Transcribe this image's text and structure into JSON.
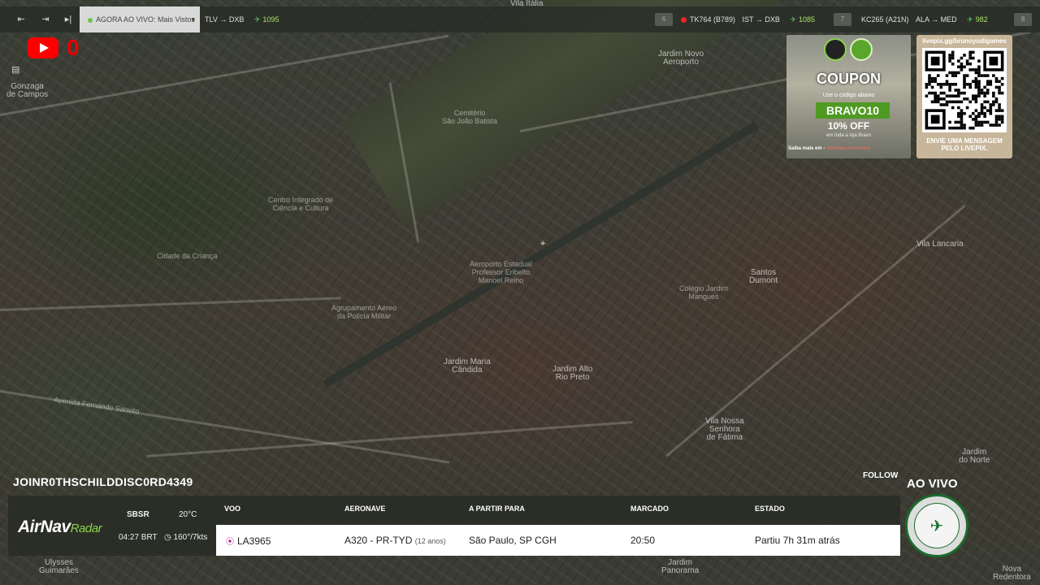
{
  "topbar": {
    "live_label": "AGORA AO VIVO: Mais Vistos",
    "route1": "TLV → DXB",
    "route1_count": "1095",
    "box1": "6",
    "flight2": "TK764 (B789)",
    "route2": "IST → DXB",
    "route2_count": "1085",
    "box2": "7",
    "flight3": "KC265 (A21N)",
    "route3": "ALA → MED",
    "route3_count": "982",
    "box3": "8"
  },
  "youtube": {
    "count": "0"
  },
  "map": {
    "labels": {
      "gonzaga": "Gonzaga\nde Campos",
      "jardim_novo": "Jardim Novo\nAeroporto",
      "vila_italia": "Vila Itália",
      "vila_lancaria": "Vila Lancaria",
      "santos_dumont": "Santos\nDumont",
      "aeroporto": "Aeroporto Estadual\nProfessor Eribelto\nManoel Reino",
      "cidade_crianca": "Cidade da Criança",
      "centro_integrado": "Centro Integrado de\nCiência e Cultura",
      "agrupamento": "Agrupamento Aéreo\nda Polícia Militar",
      "jardim_maria": "Jardim Maria\nCândida",
      "jardim_alto": "Jardim Alto\nRio Preto",
      "vila_nossa": "Vila Nossa\nSenhora\nde Fátima",
      "jardim_norte": "Jardim\ndo Norte",
      "cemiterio": "Cemitério\nSão João Batista",
      "colegio": "Colégio Jardim\nMangues",
      "ulysses": "Ulysses\nGuimarães",
      "jardim_panorama": "Jardim\nPanorama",
      "nova_redentora": "Nova\nRedentora",
      "av_fernando": "Avenida Fernando Sanvito"
    }
  },
  "coupon": {
    "title": "COUPON",
    "sub": "Use o código abaixo",
    "code": "BRAVO10",
    "off": "10% OFF",
    "note": "em toda a loja Bravo",
    "url_prefix": "Saiba mais em -",
    "url_link": "sitebrado.com/bravo"
  },
  "qr": {
    "url": "livepix.gg/brunoyudigames",
    "message": "ENVIE UMA MENSAGEM\nPELO LIVEPIX."
  },
  "panel": {
    "username": "JOINR0THSCHILDDISC0RD4349",
    "follow": "FOLLOW",
    "airnav": "AirNav",
    "radar": "Radar",
    "airport": "SBSR",
    "temp": "20°C",
    "time": "04:27 BRT",
    "wind": "160°/7kts",
    "columns": {
      "voo": "VOO",
      "aeronave": "AERONAVE",
      "apartir": "A PARTIR PARA",
      "marcado": "MARCADO",
      "estado": "ESTADO"
    },
    "row": {
      "flight": "LA3965",
      "aircraft": "A320 - PR-TYD",
      "age": "(12 anos)",
      "route": "São Paulo, SP CGH",
      "scheduled": "20:50",
      "status": "Partiu 7h 31m atrás"
    },
    "ao_vivo": "AO VIVO"
  },
  "colors": {
    "accent_green": "#57c05a",
    "youtube_red": "#ff0000",
    "badge_green": "#1a6d2d"
  },
  "icons": {
    "collapse": "sidebar-collapse-icon",
    "expand": "expand-icon",
    "next": "skip-next-icon",
    "plane": "plane-icon",
    "pin": "location-pin-icon",
    "list": "list-icon"
  }
}
